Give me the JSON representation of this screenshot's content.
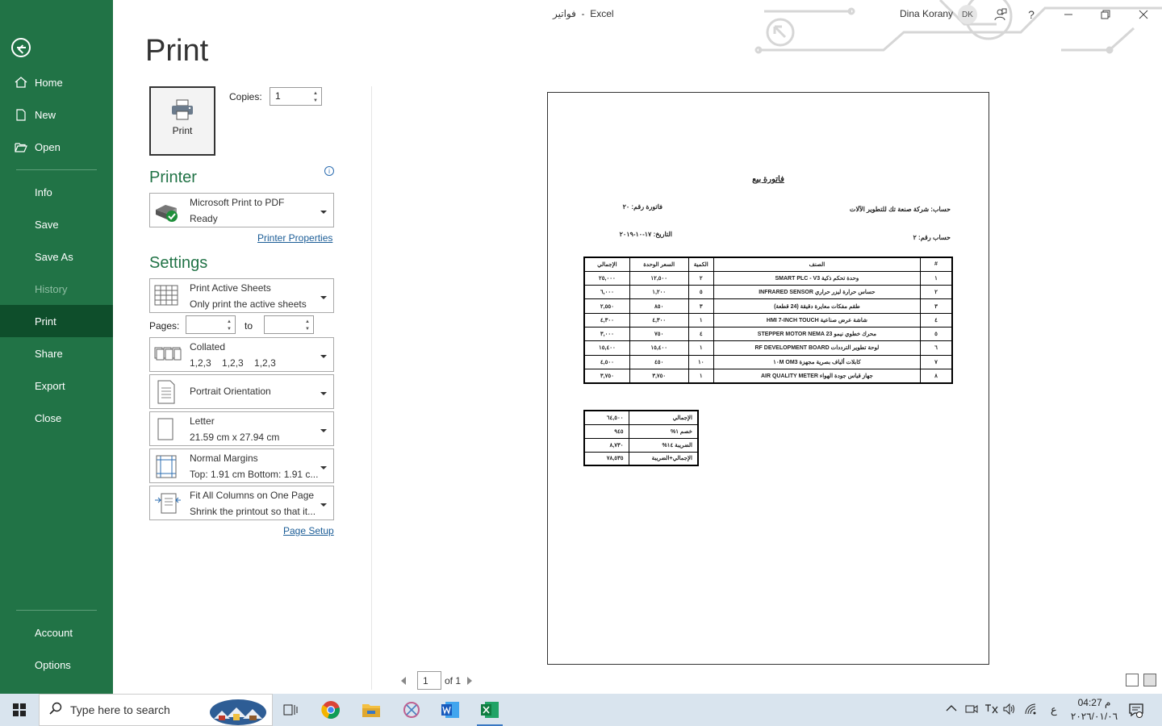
{
  "app": {
    "doc_title": "فواتير",
    "app_name": "Excel",
    "user_name": "Dina Korany",
    "user_initials": "DK",
    "help": "?"
  },
  "nav": {
    "home": "Home",
    "new": "New",
    "open": "Open",
    "info": "Info",
    "save": "Save",
    "save_as": "Save As",
    "history": "History",
    "print": "Print",
    "share": "Share",
    "export": "Export",
    "close": "Close",
    "account": "Account",
    "options": "Options"
  },
  "print": {
    "heading": "Print",
    "button_label": "Print",
    "copies_label": "Copies:",
    "copies_value": "1",
    "printer_section": "Printer",
    "printer_name": "Microsoft Print to PDF",
    "printer_status": "Ready",
    "printer_properties": "Printer Properties",
    "settings_section": "Settings",
    "what": {
      "l1": "Print Active Sheets",
      "l2": "Only print the active sheets"
    },
    "pages_label": "Pages:",
    "to_label": "to",
    "collation": {
      "l1": "Collated",
      "l2": "1,2,3    1,2,3    1,2,3"
    },
    "orientation": "Portrait Orientation",
    "paper": {
      "l1": "Letter",
      "l2": "21.59 cm x 27.94 cm"
    },
    "margins": {
      "l1": "Normal Margins",
      "l2": "Top: 1.91 cm Bottom: 1.91 c..."
    },
    "scaling": {
      "l1": "Fit All Columns on One Page",
      "l2": "Shrink the printout so that it..."
    },
    "page_setup": "Page Setup",
    "page_nav": {
      "current": "1",
      "of_label": "of 1"
    }
  },
  "invoice": {
    "title": "فاتورة بيع",
    "invoice_no": "فاتورة رقم:   ٢٠",
    "account": "حساب: شركة صنعة تك للتطوير الآلات",
    "date": "التاريخ:  ١٧-١٠-٢٠١٩",
    "account_no": "حساب رقم: ٢",
    "headers": [
      "#",
      "الصنف",
      "الكمية",
      "السعر الوحدة",
      "الإجمالي"
    ],
    "rows": [
      [
        "١",
        "وحدة تحكم ذكية SMART PLC - V3",
        "٢",
        "١٢,٥٠٠",
        "٢٥,٠٠٠"
      ],
      [
        "٢",
        "حساس حرارة ليزر حراري INFRARED SENSOR",
        "٥",
        "١,٢٠٠",
        "٦,٠٠٠"
      ],
      [
        "٣",
        "طقم مفكات معايرة دقيقة (24 قطعة)",
        "٣",
        "٨٥٠",
        "٢,٥٥٠"
      ],
      [
        "٤",
        "شاشة عرض صناعية HMI 7-INCH TOUCH",
        "١",
        "٤,٣٠٠",
        "٤,٣٠٠"
      ],
      [
        "٥",
        "محرك خطوي نيمو STEPPER MOTOR NEMA 23",
        "٤",
        "٧٥٠",
        "٣,٠٠٠"
      ],
      [
        "٦",
        "لوحة تطوير الترددات RF DEVELOPMENT BOARD",
        "١",
        "١٥,٤٠٠",
        "١٥,٤٠٠"
      ],
      [
        "٧",
        "كابلات ألياف بصرية مجهزة OM3 ١٠M",
        "١٠",
        "٤٥٠",
        "٤,٥٠٠"
      ],
      [
        "٨",
        "جهاز قياس جودة الهواء AIR QUALITY METER",
        "١",
        "٣,٧٥٠",
        "٣,٧٥٠"
      ]
    ],
    "totals": [
      [
        "الإجمالي",
        "٦٤,٥٠٠"
      ],
      [
        "خصم ١%",
        "٩٤٥"
      ],
      [
        "الضريبة ١٤%",
        "٨,٧٣٠"
      ],
      [
        "الإجمالي+الضريبة",
        "٧٨,٥٣٥"
      ]
    ]
  },
  "taskbar": {
    "search_placeholder": "Type here to search",
    "time": "04:27 م",
    "date": "٢٠٢٦/٠١/٠٦",
    "lang": "ع"
  },
  "colors": {
    "accent": "#217346",
    "active_nav": "#0e4e2b",
    "link": "#1a5c96"
  }
}
